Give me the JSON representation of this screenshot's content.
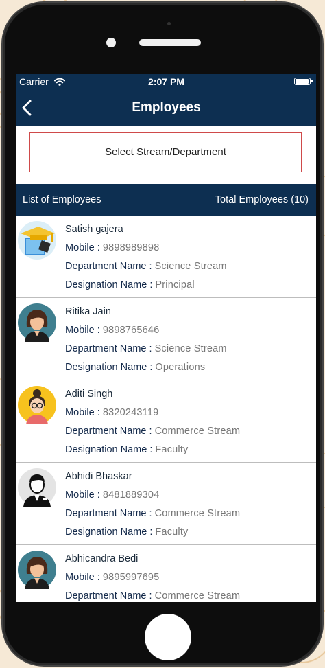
{
  "status": {
    "carrier": "Carrier",
    "time": "2:07 PM",
    "battery_level": 0.95
  },
  "nav": {
    "title": "Employees",
    "back_icon": "chevron-left-icon"
  },
  "filter": {
    "select_label": "Select Stream/Department"
  },
  "list_header": {
    "left": "List of Employees",
    "right": "Total Employees (10)"
  },
  "labels": {
    "mobile": "Mobile :",
    "department": "Department Name :",
    "designation": "Designation Name :"
  },
  "employees": [
    {
      "name": "Satish gajera",
      "mobile": "9898989898",
      "department": "Science Stream",
      "designation": "Principal",
      "avatar": "graduate-avatar-icon"
    },
    {
      "name": "Ritika Jain",
      "mobile": "9898765646",
      "department": "Science Stream",
      "designation": "Operations",
      "avatar": "woman-avatar-icon"
    },
    {
      "name": "Aditi Singh",
      "mobile": "8320243119",
      "department": "Commerce  Stream",
      "designation": "Faculty",
      "avatar": "woman-glasses-avatar-icon"
    },
    {
      "name": "Abhidi Bhaskar",
      "mobile": "8481889304",
      "department": "Commerce  Stream",
      "designation": "Faculty",
      "avatar": "man-suit-avatar-icon"
    },
    {
      "name": "Abhicandra Bedi",
      "mobile": "9895997695",
      "department": "Commerce  Stream",
      "designation": "",
      "avatar": "woman-avatar-icon"
    }
  ],
  "colors": {
    "navy": "#0d2f51",
    "border_red": "#cf4a4a",
    "value_gray": "#777777"
  }
}
